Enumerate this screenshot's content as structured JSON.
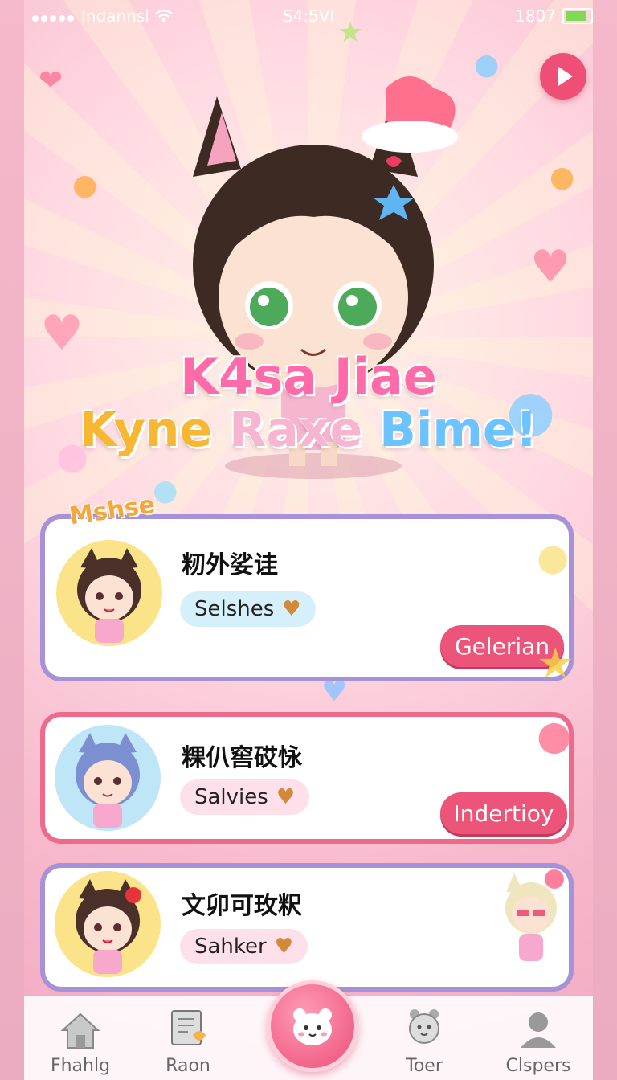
{
  "status_bar": {
    "carrier": "Indannsl",
    "time": "S4:5VI",
    "battery_text": "1807"
  },
  "hero": {
    "title_line1": "K4sa Jiae",
    "title_line2_words": [
      "Kyne",
      "Raxe",
      "Bime!"
    ]
  },
  "badge": "Mshse",
  "cards": [
    {
      "name": "籾外娑诖",
      "tag": "Selshes",
      "action": "Gelerian",
      "pill_color": "#d6f0fb"
    },
    {
      "name": "粿仈窖砹怺",
      "tag": "Salvies",
      "action": "Indertioy",
      "pill_color": "#fde0ea"
    },
    {
      "name": "文卯可玫粎",
      "tag": "Sahker",
      "action": "",
      "pill_color": "#fde0ea"
    }
  ],
  "nav": [
    {
      "label": "Fhahlg",
      "icon": "home-icon"
    },
    {
      "label": "Raon",
      "icon": "notes-icon"
    },
    {
      "label": "Toer",
      "icon": "bear-icon"
    },
    {
      "label": "Clspers",
      "icon": "profile-icon"
    }
  ],
  "colors": {
    "accent": "#ec5479",
    "card_border_purple": "#a692d8",
    "card_border_pink": "#ee6a8c"
  }
}
